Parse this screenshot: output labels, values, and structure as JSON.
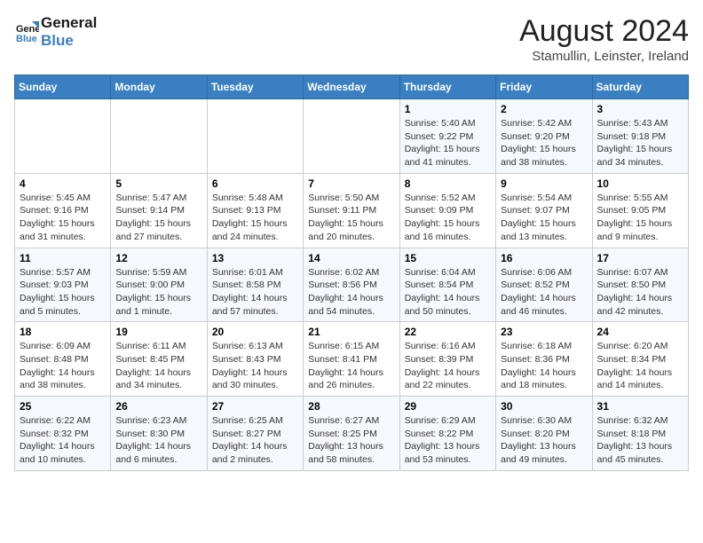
{
  "header": {
    "logo_line1": "General",
    "logo_line2": "Blue",
    "main_title": "August 2024",
    "subtitle": "Stamullin, Leinster, Ireland"
  },
  "days_of_week": [
    "Sunday",
    "Monday",
    "Tuesday",
    "Wednesday",
    "Thursday",
    "Friday",
    "Saturday"
  ],
  "weeks": [
    [
      {
        "day": "",
        "info": ""
      },
      {
        "day": "",
        "info": ""
      },
      {
        "day": "",
        "info": ""
      },
      {
        "day": "",
        "info": ""
      },
      {
        "day": "1",
        "info": "Sunrise: 5:40 AM\nSunset: 9:22 PM\nDaylight: 15 hours\nand 41 minutes."
      },
      {
        "day": "2",
        "info": "Sunrise: 5:42 AM\nSunset: 9:20 PM\nDaylight: 15 hours\nand 38 minutes."
      },
      {
        "day": "3",
        "info": "Sunrise: 5:43 AM\nSunset: 9:18 PM\nDaylight: 15 hours\nand 34 minutes."
      }
    ],
    [
      {
        "day": "4",
        "info": "Sunrise: 5:45 AM\nSunset: 9:16 PM\nDaylight: 15 hours\nand 31 minutes."
      },
      {
        "day": "5",
        "info": "Sunrise: 5:47 AM\nSunset: 9:14 PM\nDaylight: 15 hours\nand 27 minutes."
      },
      {
        "day": "6",
        "info": "Sunrise: 5:48 AM\nSunset: 9:13 PM\nDaylight: 15 hours\nand 24 minutes."
      },
      {
        "day": "7",
        "info": "Sunrise: 5:50 AM\nSunset: 9:11 PM\nDaylight: 15 hours\nand 20 minutes."
      },
      {
        "day": "8",
        "info": "Sunrise: 5:52 AM\nSunset: 9:09 PM\nDaylight: 15 hours\nand 16 minutes."
      },
      {
        "day": "9",
        "info": "Sunrise: 5:54 AM\nSunset: 9:07 PM\nDaylight: 15 hours\nand 13 minutes."
      },
      {
        "day": "10",
        "info": "Sunrise: 5:55 AM\nSunset: 9:05 PM\nDaylight: 15 hours\nand 9 minutes."
      }
    ],
    [
      {
        "day": "11",
        "info": "Sunrise: 5:57 AM\nSunset: 9:03 PM\nDaylight: 15 hours\nand 5 minutes."
      },
      {
        "day": "12",
        "info": "Sunrise: 5:59 AM\nSunset: 9:00 PM\nDaylight: 15 hours\nand 1 minute."
      },
      {
        "day": "13",
        "info": "Sunrise: 6:01 AM\nSunset: 8:58 PM\nDaylight: 14 hours\nand 57 minutes."
      },
      {
        "day": "14",
        "info": "Sunrise: 6:02 AM\nSunset: 8:56 PM\nDaylight: 14 hours\nand 54 minutes."
      },
      {
        "day": "15",
        "info": "Sunrise: 6:04 AM\nSunset: 8:54 PM\nDaylight: 14 hours\nand 50 minutes."
      },
      {
        "day": "16",
        "info": "Sunrise: 6:06 AM\nSunset: 8:52 PM\nDaylight: 14 hours\nand 46 minutes."
      },
      {
        "day": "17",
        "info": "Sunrise: 6:07 AM\nSunset: 8:50 PM\nDaylight: 14 hours\nand 42 minutes."
      }
    ],
    [
      {
        "day": "18",
        "info": "Sunrise: 6:09 AM\nSunset: 8:48 PM\nDaylight: 14 hours\nand 38 minutes."
      },
      {
        "day": "19",
        "info": "Sunrise: 6:11 AM\nSunset: 8:45 PM\nDaylight: 14 hours\nand 34 minutes."
      },
      {
        "day": "20",
        "info": "Sunrise: 6:13 AM\nSunset: 8:43 PM\nDaylight: 14 hours\nand 30 minutes."
      },
      {
        "day": "21",
        "info": "Sunrise: 6:15 AM\nSunset: 8:41 PM\nDaylight: 14 hours\nand 26 minutes."
      },
      {
        "day": "22",
        "info": "Sunrise: 6:16 AM\nSunset: 8:39 PM\nDaylight: 14 hours\nand 22 minutes."
      },
      {
        "day": "23",
        "info": "Sunrise: 6:18 AM\nSunset: 8:36 PM\nDaylight: 14 hours\nand 18 minutes."
      },
      {
        "day": "24",
        "info": "Sunrise: 6:20 AM\nSunset: 8:34 PM\nDaylight: 14 hours\nand 14 minutes."
      }
    ],
    [
      {
        "day": "25",
        "info": "Sunrise: 6:22 AM\nSunset: 8:32 PM\nDaylight: 14 hours\nand 10 minutes."
      },
      {
        "day": "26",
        "info": "Sunrise: 6:23 AM\nSunset: 8:30 PM\nDaylight: 14 hours\nand 6 minutes."
      },
      {
        "day": "27",
        "info": "Sunrise: 6:25 AM\nSunset: 8:27 PM\nDaylight: 14 hours\nand 2 minutes."
      },
      {
        "day": "28",
        "info": "Sunrise: 6:27 AM\nSunset: 8:25 PM\nDaylight: 13 hours\nand 58 minutes."
      },
      {
        "day": "29",
        "info": "Sunrise: 6:29 AM\nSunset: 8:22 PM\nDaylight: 13 hours\nand 53 minutes."
      },
      {
        "day": "30",
        "info": "Sunrise: 6:30 AM\nSunset: 8:20 PM\nDaylight: 13 hours\nand 49 minutes."
      },
      {
        "day": "31",
        "info": "Sunrise: 6:32 AM\nSunset: 8:18 PM\nDaylight: 13 hours\nand 45 minutes."
      }
    ]
  ]
}
